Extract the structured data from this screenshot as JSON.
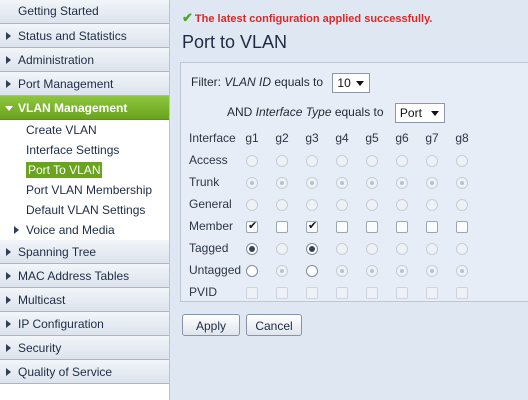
{
  "sidebar": {
    "top_items": [
      {
        "label": "Getting Started"
      },
      {
        "label": "Status and Statistics"
      },
      {
        "label": "Administration"
      },
      {
        "label": "Port Management"
      },
      {
        "label": "VLAN Management"
      }
    ],
    "vlan_sub_items": [
      {
        "label": "Create VLAN"
      },
      {
        "label": "Interface Settings"
      },
      {
        "label": "Port To VLAN"
      },
      {
        "label": "Port VLAN Membership"
      },
      {
        "label": "Default VLAN Settings"
      },
      {
        "label": "Voice and Media"
      }
    ],
    "bottom_items": [
      {
        "label": "Spanning Tree"
      },
      {
        "label": "MAC Address Tables"
      },
      {
        "label": "Multicast"
      },
      {
        "label": "IP Configuration"
      },
      {
        "label": "Security"
      },
      {
        "label": "Quality of Service"
      }
    ]
  },
  "status_message": "The latest configuration applied successfully.",
  "page_title": "Port to VLAN",
  "filter": {
    "label_prefix": "Filter: ",
    "label_field": "VLAN ID",
    "label_suffix": " equals to",
    "vlan_value": "10",
    "and_prefix": "AND ",
    "and_field": "Interface Type",
    "and_suffix": " equals to",
    "interface_type_value": "Port"
  },
  "grid": {
    "interface_label": "Interface",
    "ports": [
      "g1",
      "g2",
      "g3",
      "g4",
      "g5",
      "g6",
      "g7",
      "g8"
    ],
    "rows": [
      "Access",
      "Trunk",
      "General",
      "Member",
      "Tagged",
      "Untagged",
      "PVID"
    ]
  },
  "buttons": {
    "apply": "Apply",
    "cancel": "Cancel"
  },
  "colors": {
    "accent": "#6aa31d",
    "status_text": "#d62b2b",
    "check_icon": "#4aa82a"
  }
}
